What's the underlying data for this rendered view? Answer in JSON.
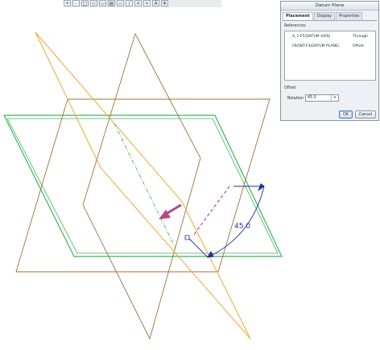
{
  "toolbar": {
    "buttons": [
      {
        "name": "zoom-in-icon",
        "glyph": "+"
      },
      {
        "name": "zoom-out-icon",
        "glyph": "-"
      },
      {
        "name": "refit-icon",
        "glyph": "□"
      },
      {
        "name": "repaint-icon",
        "glyph": "◇"
      },
      {
        "name": "datum-display-icon",
        "glyph": "▭"
      },
      {
        "name": "view-manager-icon",
        "glyph": "▤"
      },
      {
        "name": "datum-plane-icon",
        "glyph": "▱"
      },
      {
        "name": "datum-axis-icon",
        "glyph": "/"
      },
      {
        "name": "datum-point-icon",
        "glyph": "×"
      },
      {
        "name": "coordinate-system-icon",
        "glyph": "⌖"
      },
      {
        "name": "annotation-icon",
        "glyph": "A"
      },
      {
        "name": "spin-center-icon",
        "glyph": "✲"
      }
    ]
  },
  "dialog": {
    "title": "Datum Plane",
    "tabs": [
      "Placement",
      "Display",
      "Properties"
    ],
    "active_tab": "Placement",
    "references_label": "References",
    "references": [
      {
        "name": "A_1:F5(DATUM AXIS)",
        "type": "Through"
      },
      {
        "name": "FRONT:F3(DATUM PLANE)",
        "type": "Offset"
      }
    ],
    "offset_label": "Offset",
    "rotation_label": "Rotation",
    "rotation_value": "45.0",
    "ok_label": "OK",
    "cancel_label": "Cancel"
  },
  "viewport": {
    "angle_label": "45.0",
    "colors": {
      "brown_plane": "#a0703c",
      "orange_plane": "#f0a830",
      "green_plane": "#3cb45a",
      "axis": "#32b43c",
      "dimension": "#2030a0",
      "preview": "#a0205a",
      "direction_arrow": "#b04a80"
    }
  }
}
